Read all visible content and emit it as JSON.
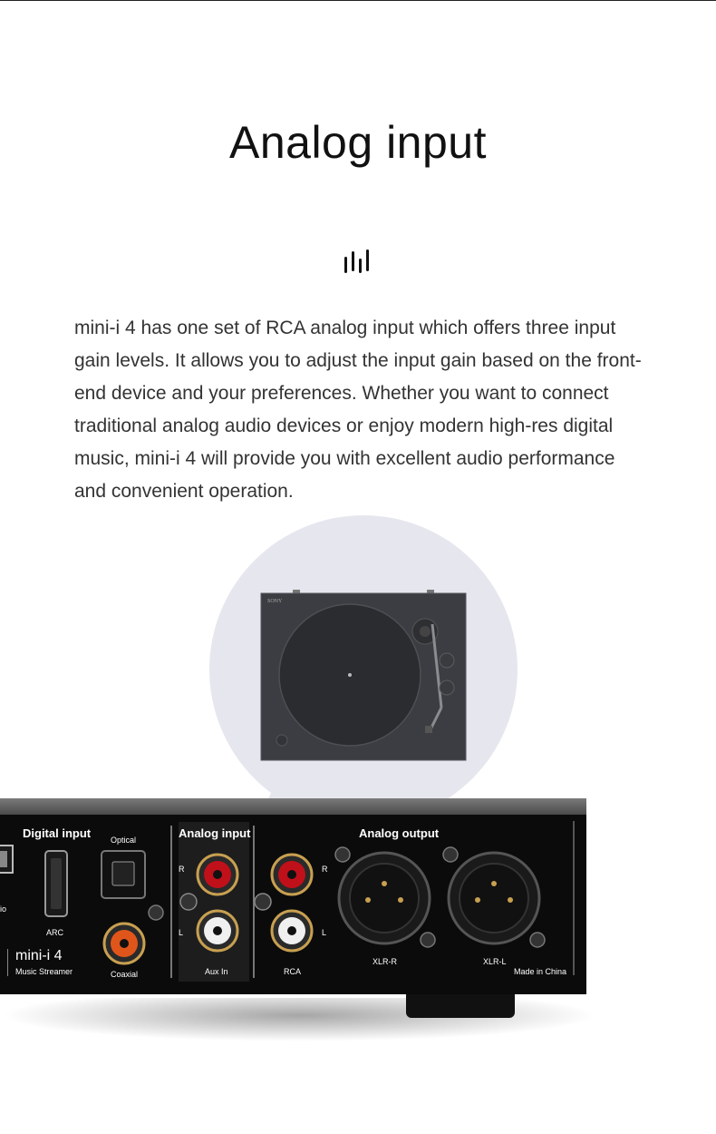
{
  "heading": "Analog input",
  "icon": "equalizer-bars-icon",
  "description": "mini-i 4 has one set of RCA analog input which offers three input gain levels. It allows you to adjust the input gain based on the front-end device and your preferences. Whether you want to connect traditional analog audio devices or enjoy modern high-res digital music, mini-i 4 will provide you with excellent audio performance and convenient operation.",
  "turntable": {
    "brand": "SONY"
  },
  "device": {
    "sections": {
      "digital_input": "Digital input",
      "analog_input": "Analog input",
      "analog_output": "Analog output"
    },
    "port_labels": {
      "optical": "Optical",
      "arc": "ARC",
      "coaxial": "Coaxial",
      "aux_in": "Aux In",
      "rca": "RCA",
      "xlr_r": "XLR-R",
      "xlr_l": "XLR-L",
      "made_in": "Made in China",
      "partial_left": "io"
    },
    "channels": {
      "r": "R",
      "l": "L"
    },
    "model": "mini-i 4",
    "subtitle": "Music Streamer"
  },
  "colors": {
    "bubble": "#e6e6ee",
    "rca_red": "#c0101a",
    "rca_white": "#f0f0f0",
    "coax_orange": "#e0561a"
  }
}
